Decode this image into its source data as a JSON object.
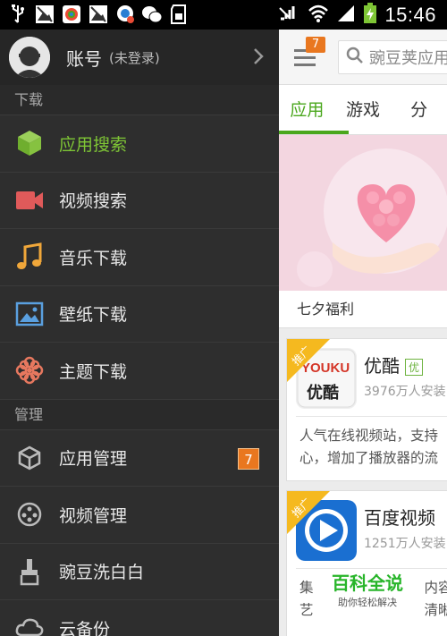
{
  "status_bar": {
    "time": "15:46",
    "left_icons": [
      "usb-icon",
      "image-icon",
      "app-store-icon",
      "image-icon",
      "security-icon",
      "wechat-icon",
      "sd-card-icon"
    ],
    "right_icons": [
      "signal-muted-icon",
      "wifi-icon",
      "signal-bars-icon",
      "battery-charging-icon"
    ]
  },
  "drawer": {
    "account": {
      "name": "账号",
      "sub": "(未登录)"
    },
    "sections": [
      {
        "header": "下载",
        "items": [
          {
            "label": "应用搜索",
            "icon": "cube-icon",
            "active": true
          },
          {
            "label": "视频搜索",
            "icon": "video-camera-icon"
          },
          {
            "label": "音乐下载",
            "icon": "music-note-icon"
          },
          {
            "label": "壁纸下载",
            "icon": "picture-icon"
          },
          {
            "label": "主题下载",
            "icon": "flower-icon"
          }
        ]
      },
      {
        "header": "管理",
        "items": [
          {
            "label": "应用管理",
            "icon": "box-icon",
            "badge": "7"
          },
          {
            "label": "视频管理",
            "icon": "film-reel-icon"
          },
          {
            "label": "豌豆洗白白",
            "icon": "broom-icon"
          },
          {
            "label": "云备份",
            "icon": "cloud-icon"
          }
        ]
      }
    ]
  },
  "main": {
    "menu_badge": "7",
    "search_placeholder": "豌豆荚应用",
    "tabs": [
      {
        "label": "应用",
        "active": true
      },
      {
        "label": "游戏"
      },
      {
        "label": "分"
      }
    ],
    "banner_caption": "七夕福利",
    "cards": [
      {
        "promo": "推广",
        "name": "优酷",
        "tag": "优",
        "icon_text_top": "YOUKU",
        "icon_text_bottom": "优酷",
        "count": "3976万人安装",
        "desc_lines": [
          "人气在线视频站，支持",
          "心，增加了播放器的流"
        ]
      },
      {
        "promo": "推广",
        "name": "百度视频",
        "count": "1251万人安装",
        "desc_lines": [
          "集",
          "艺"
        ],
        "desc_right": [
          "内容",
          "清晰"
        ]
      }
    ],
    "watermark": {
      "title": "百科全说",
      "sub": "助你轻松解决"
    }
  },
  "colors": {
    "accent_green": "#4aa71c",
    "drawer_bg": "#2e2e2e",
    "badge_orange": "#e9771f"
  }
}
